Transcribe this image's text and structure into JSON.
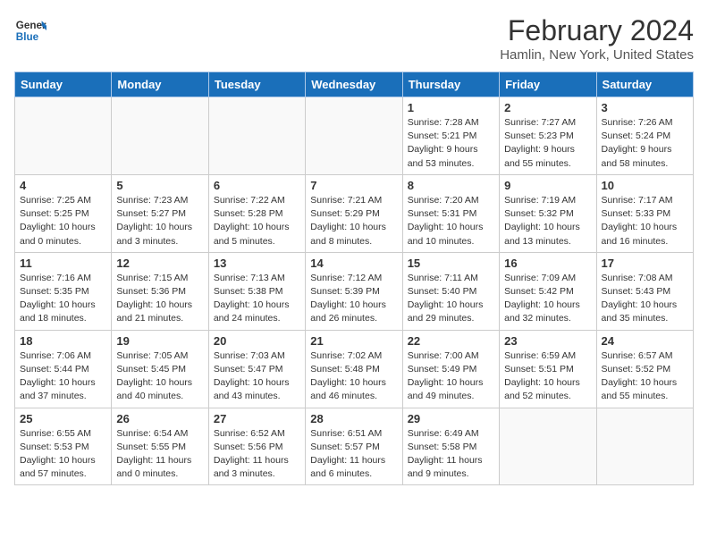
{
  "header": {
    "logo_line1": "General",
    "logo_line2": "Blue",
    "title": "February 2024",
    "subtitle": "Hamlin, New York, United States"
  },
  "days_of_week": [
    "Sunday",
    "Monday",
    "Tuesday",
    "Wednesday",
    "Thursday",
    "Friday",
    "Saturday"
  ],
  "weeks": [
    [
      {
        "day": "",
        "info": ""
      },
      {
        "day": "",
        "info": ""
      },
      {
        "day": "",
        "info": ""
      },
      {
        "day": "",
        "info": ""
      },
      {
        "day": "1",
        "info": "Sunrise: 7:28 AM\nSunset: 5:21 PM\nDaylight: 9 hours\nand 53 minutes."
      },
      {
        "day": "2",
        "info": "Sunrise: 7:27 AM\nSunset: 5:23 PM\nDaylight: 9 hours\nand 55 minutes."
      },
      {
        "day": "3",
        "info": "Sunrise: 7:26 AM\nSunset: 5:24 PM\nDaylight: 9 hours\nand 58 minutes."
      }
    ],
    [
      {
        "day": "4",
        "info": "Sunrise: 7:25 AM\nSunset: 5:25 PM\nDaylight: 10 hours\nand 0 minutes."
      },
      {
        "day": "5",
        "info": "Sunrise: 7:23 AM\nSunset: 5:27 PM\nDaylight: 10 hours\nand 3 minutes."
      },
      {
        "day": "6",
        "info": "Sunrise: 7:22 AM\nSunset: 5:28 PM\nDaylight: 10 hours\nand 5 minutes."
      },
      {
        "day": "7",
        "info": "Sunrise: 7:21 AM\nSunset: 5:29 PM\nDaylight: 10 hours\nand 8 minutes."
      },
      {
        "day": "8",
        "info": "Sunrise: 7:20 AM\nSunset: 5:31 PM\nDaylight: 10 hours\nand 10 minutes."
      },
      {
        "day": "9",
        "info": "Sunrise: 7:19 AM\nSunset: 5:32 PM\nDaylight: 10 hours\nand 13 minutes."
      },
      {
        "day": "10",
        "info": "Sunrise: 7:17 AM\nSunset: 5:33 PM\nDaylight: 10 hours\nand 16 minutes."
      }
    ],
    [
      {
        "day": "11",
        "info": "Sunrise: 7:16 AM\nSunset: 5:35 PM\nDaylight: 10 hours\nand 18 minutes."
      },
      {
        "day": "12",
        "info": "Sunrise: 7:15 AM\nSunset: 5:36 PM\nDaylight: 10 hours\nand 21 minutes."
      },
      {
        "day": "13",
        "info": "Sunrise: 7:13 AM\nSunset: 5:38 PM\nDaylight: 10 hours\nand 24 minutes."
      },
      {
        "day": "14",
        "info": "Sunrise: 7:12 AM\nSunset: 5:39 PM\nDaylight: 10 hours\nand 26 minutes."
      },
      {
        "day": "15",
        "info": "Sunrise: 7:11 AM\nSunset: 5:40 PM\nDaylight: 10 hours\nand 29 minutes."
      },
      {
        "day": "16",
        "info": "Sunrise: 7:09 AM\nSunset: 5:42 PM\nDaylight: 10 hours\nand 32 minutes."
      },
      {
        "day": "17",
        "info": "Sunrise: 7:08 AM\nSunset: 5:43 PM\nDaylight: 10 hours\nand 35 minutes."
      }
    ],
    [
      {
        "day": "18",
        "info": "Sunrise: 7:06 AM\nSunset: 5:44 PM\nDaylight: 10 hours\nand 37 minutes."
      },
      {
        "day": "19",
        "info": "Sunrise: 7:05 AM\nSunset: 5:45 PM\nDaylight: 10 hours\nand 40 minutes."
      },
      {
        "day": "20",
        "info": "Sunrise: 7:03 AM\nSunset: 5:47 PM\nDaylight: 10 hours\nand 43 minutes."
      },
      {
        "day": "21",
        "info": "Sunrise: 7:02 AM\nSunset: 5:48 PM\nDaylight: 10 hours\nand 46 minutes."
      },
      {
        "day": "22",
        "info": "Sunrise: 7:00 AM\nSunset: 5:49 PM\nDaylight: 10 hours\nand 49 minutes."
      },
      {
        "day": "23",
        "info": "Sunrise: 6:59 AM\nSunset: 5:51 PM\nDaylight: 10 hours\nand 52 minutes."
      },
      {
        "day": "24",
        "info": "Sunrise: 6:57 AM\nSunset: 5:52 PM\nDaylight: 10 hours\nand 55 minutes."
      }
    ],
    [
      {
        "day": "25",
        "info": "Sunrise: 6:55 AM\nSunset: 5:53 PM\nDaylight: 10 hours\nand 57 minutes."
      },
      {
        "day": "26",
        "info": "Sunrise: 6:54 AM\nSunset: 5:55 PM\nDaylight: 11 hours\nand 0 minutes."
      },
      {
        "day": "27",
        "info": "Sunrise: 6:52 AM\nSunset: 5:56 PM\nDaylight: 11 hours\nand 3 minutes."
      },
      {
        "day": "28",
        "info": "Sunrise: 6:51 AM\nSunset: 5:57 PM\nDaylight: 11 hours\nand 6 minutes."
      },
      {
        "day": "29",
        "info": "Sunrise: 6:49 AM\nSunset: 5:58 PM\nDaylight: 11 hours\nand 9 minutes."
      },
      {
        "day": "",
        "info": ""
      },
      {
        "day": "",
        "info": ""
      }
    ]
  ]
}
